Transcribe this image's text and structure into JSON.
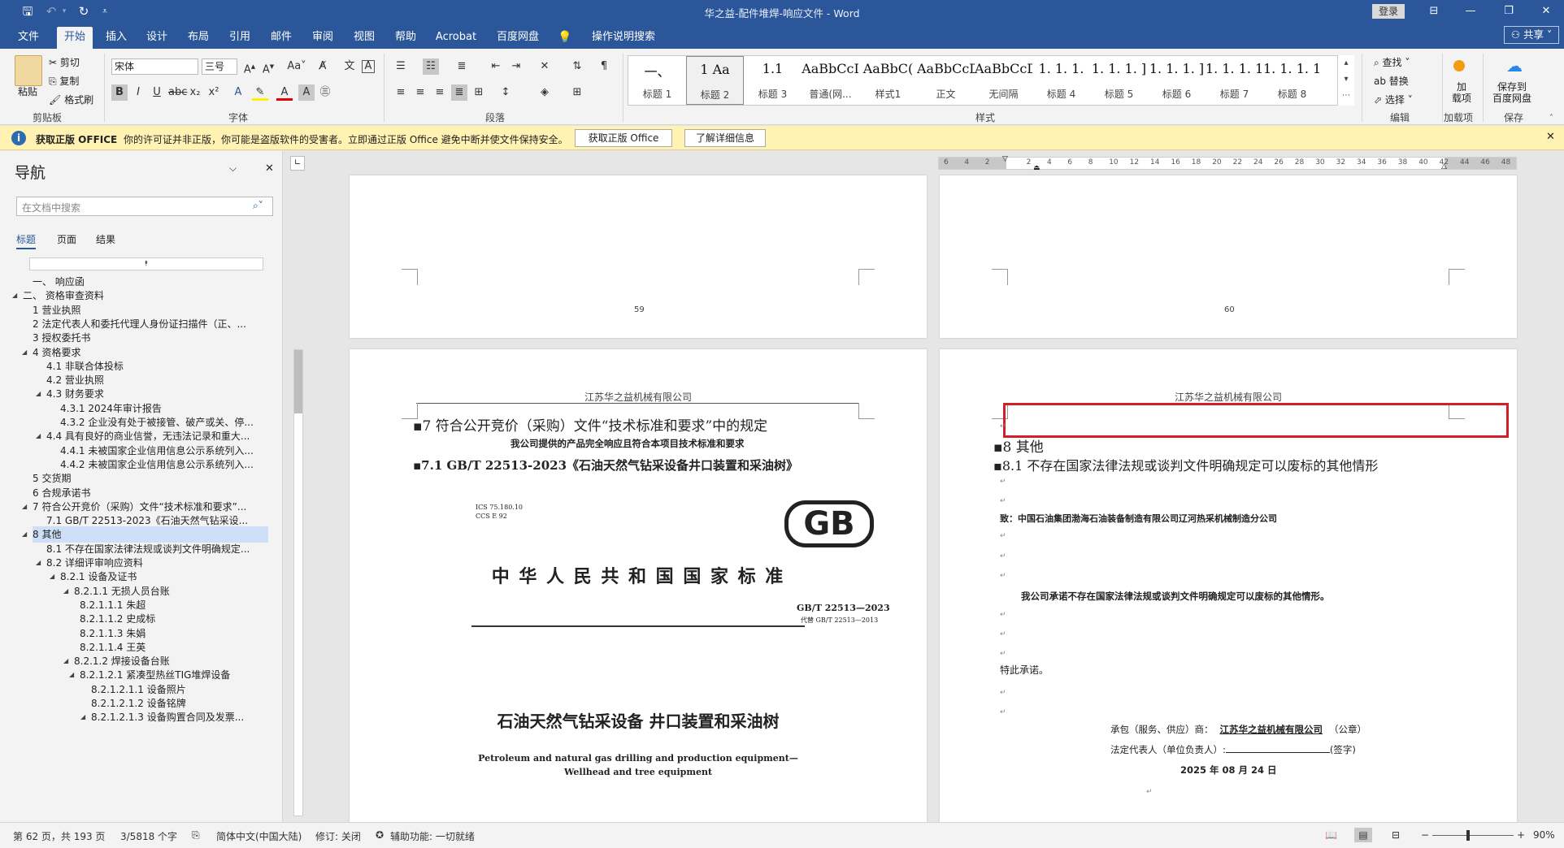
{
  "titlebar": {
    "doc_title": "华之益-配件堆焊-响应文件 - Word",
    "login": "登录"
  },
  "tabs": [
    "文件",
    "开始",
    "插入",
    "设计",
    "布局",
    "引用",
    "邮件",
    "审阅",
    "视图",
    "帮助",
    "Acrobat",
    "百度网盘",
    "操作说明搜索"
  ],
  "share": "共享",
  "ribbon": {
    "clipboard": {
      "paste": "粘贴",
      "cut": "剪切",
      "copy": "复制",
      "format_painter": "格式刷",
      "group": "剪贴板"
    },
    "font": {
      "name": "宋体",
      "size": "三号",
      "group": "字体"
    },
    "paragraph": {
      "group": "段落"
    },
    "styles": {
      "group": "样式",
      "items": [
        {
          "preview": "一、",
          "name": "标题 1"
        },
        {
          "preview": "1   Aa",
          "name": "标题 2"
        },
        {
          "preview": "1.1  ",
          "name": "标题 3"
        },
        {
          "preview": "AaBbCcI",
          "name": "普通(网..."
        },
        {
          "preview": "AaBbC(",
          "name": "样式1"
        },
        {
          "preview": "AaBbCcDdI",
          "name": "正文"
        },
        {
          "preview": "AaBbCcDdI",
          "name": "无间隔"
        },
        {
          "preview": "1. 1. 1.",
          "name": "标题 4"
        },
        {
          "preview": "1. 1. 1. ]",
          "name": "标题 5"
        },
        {
          "preview": "1. 1. 1. ]",
          "name": "标题 6"
        },
        {
          "preview": "1. 1. 1. 1",
          "name": "标题 7"
        },
        {
          "preview": "1. 1. 1. 1.",
          "name": "标题 8"
        }
      ]
    },
    "editing": {
      "find": "查找",
      "replace": "替换",
      "select": "选择",
      "group": "编辑"
    },
    "addins": {
      "label": "加\n载项",
      "group": "加载项"
    },
    "baidu": {
      "label": "保存到\n百度网盘",
      "group": "保存"
    }
  },
  "infobar": {
    "title": "获取正版 OFFICE",
    "message": "你的许可证并非正版，你可能是盗版软件的受害者。立即通过正版 Office 避免中断并使文件保持安全。",
    "btn_get": "获取正版 Office",
    "btn_learn": "了解详细信息"
  },
  "nav": {
    "title": "导航",
    "search_placeholder": "在文档中搜索",
    "tabs": [
      "标题",
      "页面",
      "结果"
    ],
    "items": [
      {
        "label": "一、 响应函",
        "level": 1,
        "tri": ""
      },
      {
        "label": "二、 资格审查资料",
        "level": 0,
        "tri": "◢"
      },
      {
        "label": "1 营业执照",
        "level": 1,
        "tri": ""
      },
      {
        "label": "2 法定代表人和委托代理人身份证扫描件（正、...",
        "level": 1,
        "tri": ""
      },
      {
        "label": "3 授权委托书",
        "level": 1,
        "tri": ""
      },
      {
        "label": "4 资格要求",
        "level": 1,
        "tri": "◢"
      },
      {
        "label": "4.1 非联合体投标",
        "level": 2,
        "tri": ""
      },
      {
        "label": "4.2 营业执照",
        "level": 2,
        "tri": ""
      },
      {
        "label": "4.3 财务要求",
        "level": 2,
        "tri": "◢"
      },
      {
        "label": "4.3.1 2024年审计报告",
        "level": 3,
        "tri": ""
      },
      {
        "label": "4.3.2 企业没有处于被接管、破产或关、停...",
        "level": 3,
        "tri": ""
      },
      {
        "label": "4.4 具有良好的商业信誉，无违法记录和重大...",
        "level": 2,
        "tri": "◢"
      },
      {
        "label": "4.4.1 未被国家企业信用信息公示系统列入...",
        "level": 3,
        "tri": ""
      },
      {
        "label": "4.4.2 未被国家企业信用信息公示系统列入...",
        "level": 3,
        "tri": ""
      },
      {
        "label": "5 交货期",
        "level": 1,
        "tri": ""
      },
      {
        "label": "6 合规承诺书",
        "level": 1,
        "tri": ""
      },
      {
        "label": "7 符合公开竞价（采购）文件“技术标准和要求”...",
        "level": 1,
        "tri": "◢"
      },
      {
        "label": "7.1 GB/T 22513-2023《石油天然气钻采设...",
        "level": 2,
        "tri": ""
      },
      {
        "label": "8 其他",
        "level": 1,
        "tri": "◢",
        "selected": true
      },
      {
        "label": "8.1 不存在国家法律法规或谈判文件明确规定...",
        "level": 2,
        "tri": ""
      },
      {
        "label": "8.2 详细评审响应资料",
        "level": 2,
        "tri": "◢"
      },
      {
        "label": "8.2.1 设备及证书",
        "level": 3,
        "tri": "◢"
      },
      {
        "label": "8.2.1.1 无损人员台账",
        "level": 4,
        "tri": "◢"
      },
      {
        "label": "8.2.1.1.1 朱超",
        "level": 5,
        "tri": ""
      },
      {
        "label": "8.2.1.1.2 史成标",
        "level": 5,
        "tri": ""
      },
      {
        "label": "8.2.1.1.3 朱娟",
        "level": 5,
        "tri": ""
      },
      {
        "label": "8.2.1.1.4 王英",
        "level": 5,
        "tri": ""
      },
      {
        "label": "8.2.1.2 焊接设备台账",
        "level": 4,
        "tri": "◢"
      },
      {
        "label": "8.2.1.2.1 紧凑型热丝TIG堆焊设备",
        "level": 5,
        "tri": "◢"
      },
      {
        "label": "8.2.1.2.1.1 设备照片",
        "level": 6,
        "tri": ""
      },
      {
        "label": "8.2.1.2.1.2 设备铭牌",
        "level": 6,
        "tri": ""
      },
      {
        "label": "8.2.1.2.1.3 设备购置合同及发票...",
        "level": 6,
        "tri": "◢"
      }
    ]
  },
  "pages": {
    "p59": "59",
    "p60": "60",
    "header_left": "江苏华之益机械有限公司",
    "header_right": "江苏华之益机械有限公司",
    "left": {
      "h7": "7    符合公开竞价（采购）文件“技术标准和要求”中的规定",
      "sub": "我公司提供的产品完全响应且符合本项目技术标准和要求",
      "h71": "7.1   GB/T 22513-2023《石油天然气钻采设备井口装置和采油树》",
      "ics": "ICS 75.180.10",
      "ccs": "CCS E 92",
      "gb_logo": "GB",
      "national_std": "中 华 人 民 共 和 国 国 家 标 准",
      "std_no": "GB/T 22513—2023",
      "replace": "代替 GB/T 22513—2013",
      "cn_title": "石油天然气钻采设备   井口装置和采油树",
      "en_title1": "Petroleum and natural gas drilling and production equipment—",
      "en_title2": "Wellhead and tree equipment"
    },
    "right": {
      "h8": "8     其他",
      "h81": "8.1   不存在国家法律法规或谈判文件明确规定可以废标的其他情形",
      "to": "致：中国石油集团渤海石油装备制造有限公司辽河热采机械制造分公司",
      "promise": "我公司承诺不存在国家法律法规或谈判文件明确规定可以废标的其他情形。",
      "special": "特此承诺。",
      "contractor_label": "承包（服务、供应）商：",
      "contractor_value": "江苏华之益机械有限公司",
      "seal": "（公章）",
      "rep_label": "法定代表人（单位负责人）:",
      "sign": "(签字)",
      "date": "2025 年 08 月 24 日"
    }
  },
  "ruler": {
    "ticks": [
      "6",
      "4",
      "2",
      "",
      "2",
      "4",
      "6",
      "8",
      "10",
      "12",
      "14",
      "16",
      "18",
      "20",
      "22",
      "24",
      "26",
      "28",
      "30",
      "32",
      "34",
      "36",
      "38",
      "40",
      "42",
      "44",
      "46",
      "48"
    ]
  },
  "status": {
    "page": "第 62 页，共 193 页",
    "words": "3/5818 个字",
    "lang": "简体中文(中国大陆)",
    "track": "修订: 关闭",
    "access": "辅助功能: 一切就绪",
    "zoom": "90%"
  },
  "colors": {
    "brand": "#2b579a",
    "highlight_box": "#d0202a",
    "info_bg": "#fff2b3"
  }
}
